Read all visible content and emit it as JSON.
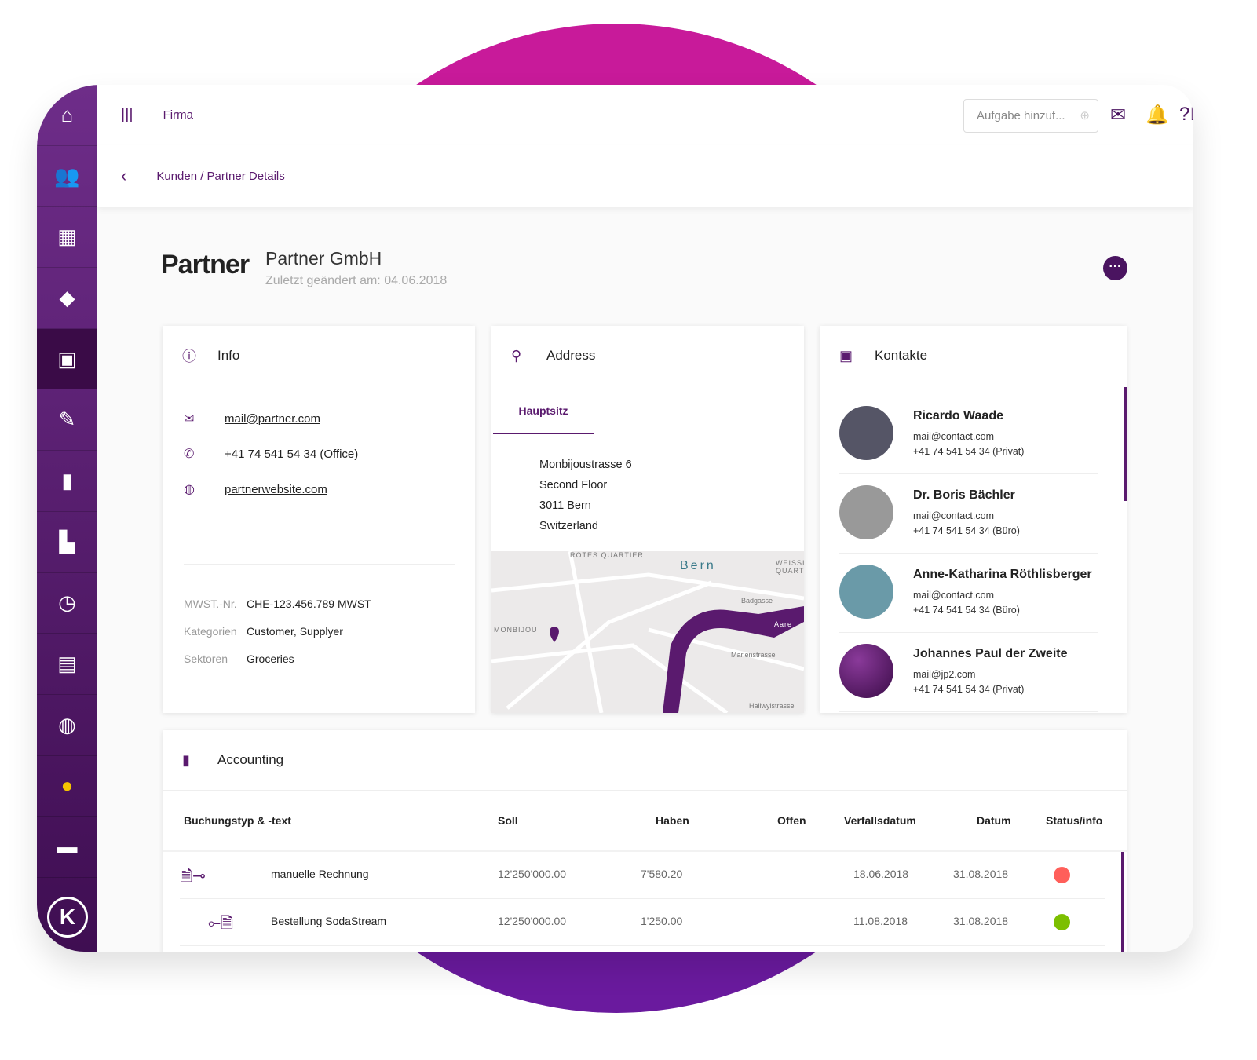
{
  "topbar": {
    "menu_label": "Firma",
    "search_placeholder": "Aufgabe hinzuf...",
    "icons": [
      "mail-icon",
      "bell-icon",
      "help-icon",
      "user-icon"
    ]
  },
  "breadcrumb": "Kunden / Partner Details",
  "company": {
    "logo_text": "Partner",
    "name": "Partner GmbH",
    "modified": "Zuletzt geändert am: 04.06.2018"
  },
  "sidebar": {
    "items": [
      "home",
      "users",
      "buildings",
      "tag",
      "contacts",
      "tasks",
      "book",
      "boot",
      "clock",
      "calendar",
      "globe",
      "coin",
      "folder"
    ],
    "active": "contacts"
  },
  "info": {
    "title": "Info",
    "email": "mail@partner.com",
    "phone": "+41 74 541 54 34 (Office)",
    "website": "partnerwebsite.com",
    "fields": [
      {
        "label": "MWST.-Nr.",
        "value": "CHE-123.456.789 MWST"
      },
      {
        "label": "Kategorien",
        "value": "Customer, Supplyer"
      },
      {
        "label": "Sektoren",
        "value": "Groceries"
      }
    ]
  },
  "address": {
    "title": "Address",
    "tab": "Hauptsitz",
    "lines": [
      "Monbijoustrasse 6",
      "Second Floor",
      "3011 Bern",
      "Switzerland"
    ],
    "map_labels": [
      "ROTES QUARTIER",
      "Bern",
      "WEISSI QUARTI",
      "MONBIJOU",
      "Aare",
      "Marienstrasse",
      "Badgasse",
      "Hallwylstrasse"
    ]
  },
  "contacts": {
    "title": "Kontakte",
    "items": [
      {
        "name": "Ricardo Waade",
        "email": "mail@contact.com",
        "phone": "+41 74 541 54 34 (Privat)"
      },
      {
        "name": "Dr. Boris Bächler",
        "email": "mail@contact.com",
        "phone": "+41 74 541 54 34 (Büro)"
      },
      {
        "name": "Anne-Katharina Röthlisberger",
        "email": "mail@contact.com",
        "phone": "+41 74 541 54 34 (Büro)"
      },
      {
        "name": "Johannes Paul der Zweite",
        "email": "mail@jp2.com",
        "phone": "+41 74 541 54 34 (Privat)"
      }
    ]
  },
  "accounting": {
    "title": "Accounting",
    "columns": [
      "Buchungstyp & -text",
      "Soll",
      "Haben",
      "Offen",
      "Verfallsdatum",
      "Datum",
      "Status/info"
    ],
    "rows": [
      {
        "text": "manuelle Rechnung",
        "soll": "12'250'000.00",
        "haben": "7'580.20",
        "offen": "",
        "verfall": "18.06.2018",
        "datum": "31.08.2018",
        "status": "#ff5f5a"
      },
      {
        "text": "Bestellung SodaStream",
        "soll": "12'250'000.00",
        "haben": "1'250.00",
        "offen": "",
        "verfall": "11.08.2018",
        "datum": "31.08.2018",
        "status": "#7cbf00"
      }
    ]
  },
  "colors": {
    "accent": "#5a1a6e",
    "sidebar": "#6e2d89",
    "blob_top": "#c81a9a",
    "blob_bottom": "#6a1a9e"
  }
}
